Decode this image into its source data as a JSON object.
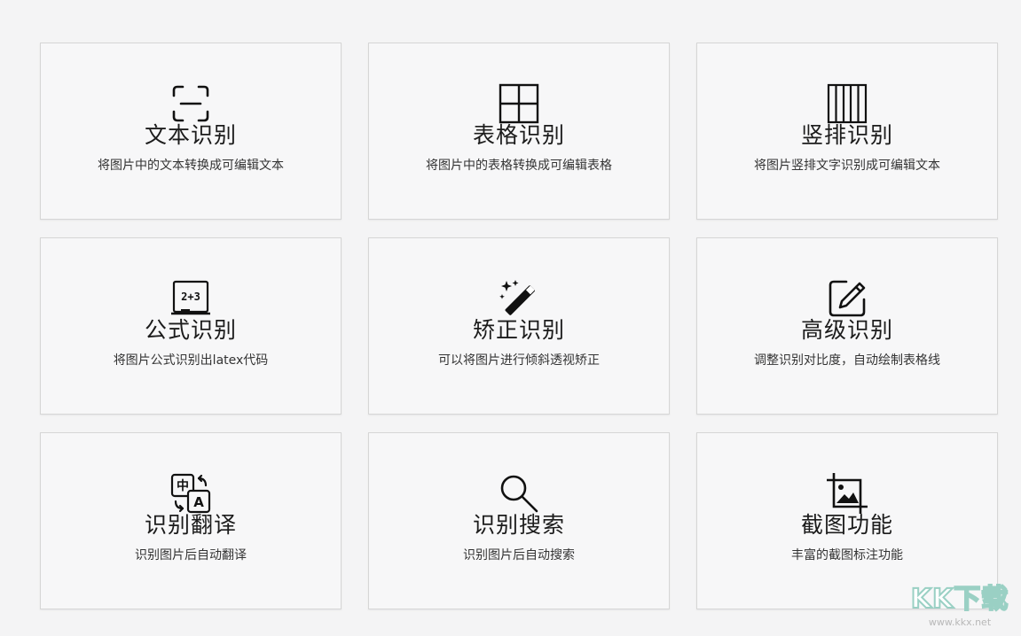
{
  "cards": [
    {
      "icon": "text-scan-icon",
      "title": "文本识别",
      "desc": "将图片中的文本转换成可编辑文本"
    },
    {
      "icon": "table-grid-icon",
      "title": "表格识别",
      "desc": "将图片中的表格转换成可编辑表格"
    },
    {
      "icon": "vertical-columns-icon",
      "title": "竖排识别",
      "desc": "将图片竖排文字识别成可编辑文本"
    },
    {
      "icon": "formula-board-icon",
      "title": "公式识别",
      "desc": "将图片公式识别出latex代码",
      "icon_text": "2+3"
    },
    {
      "icon": "magic-wand-icon",
      "title": "矫正识别",
      "desc": "可以将图片进行倾斜透视矫正"
    },
    {
      "icon": "edit-pencil-icon",
      "title": "高级识别",
      "desc": "调整识别对比度，自动绘制表格线"
    },
    {
      "icon": "translate-icon",
      "title": "识别翻译",
      "desc": "识别图片后自动翻译",
      "icon_text": [
        "中",
        "A"
      ]
    },
    {
      "icon": "search-icon",
      "title": "识别搜索",
      "desc": "识别图片后自动搜索"
    },
    {
      "icon": "crop-image-icon",
      "title": "截图功能",
      "desc": "丰富的截图标注功能"
    }
  ],
  "watermark": {
    "logo": "KK下载",
    "url": "www.kkx.net"
  }
}
